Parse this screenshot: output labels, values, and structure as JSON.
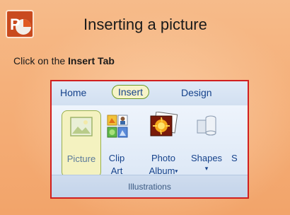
{
  "slide": {
    "title": "Inserting a picture",
    "instruction_prefix": "Click on the ",
    "instruction_bold": "Insert Tab"
  },
  "ribbon": {
    "tabs": [
      "Home",
      "Insert",
      "Design"
    ],
    "active_tab": "Insert",
    "buttons": {
      "picture": "Picture",
      "clip_art_line1": "Clip",
      "clip_art_line2": "Art",
      "photo_album_line1": "Photo",
      "photo_album_line2": "Album",
      "photo_album_arrow": "▾",
      "shapes_line1": "Shapes",
      "shapes_arrow": "▾",
      "cut_next": "S"
    },
    "group_label": "Illustrations"
  },
  "colors": {
    "background": "#f5b07a",
    "ribbon_border": "#d11f1f",
    "tab_text": "#15428b",
    "highlight_fill": "#f4f2c0",
    "highlight_border": "#99b04a"
  },
  "icons": {
    "logo": "powerpoint-logo-icon",
    "picture": "picture-icon",
    "clip_art": "clip-art-icon",
    "photo_album": "photo-album-icon",
    "shapes": "shapes-icon"
  }
}
